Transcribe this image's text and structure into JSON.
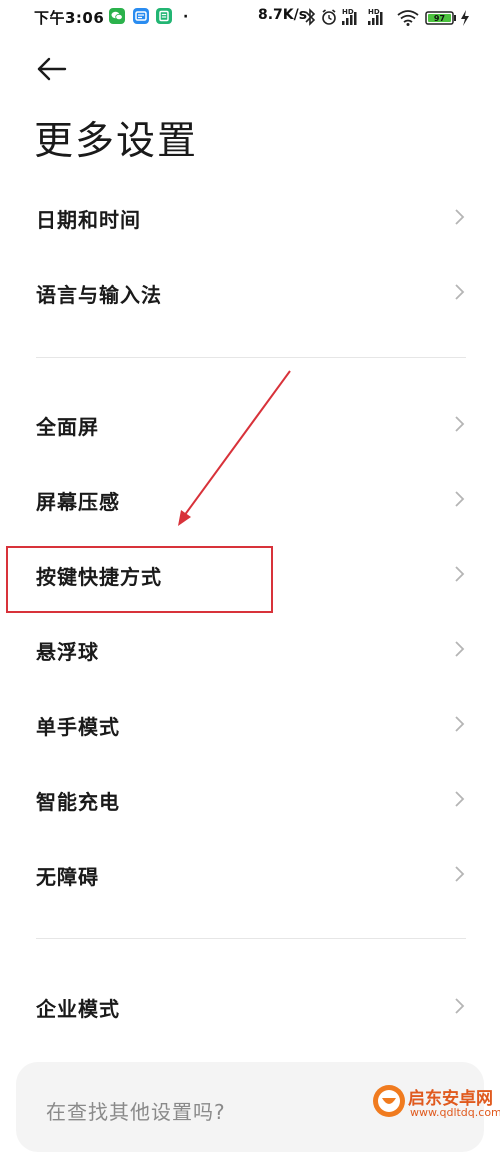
{
  "status_bar": {
    "time": "下午3:06",
    "dot": "·",
    "net_speed": "8.7K/s",
    "signal_label": "HD",
    "battery": "97"
  },
  "header": {
    "title": "更多设置"
  },
  "settings": {
    "group1": [
      "日期和时间",
      "语言与输入法"
    ],
    "group2": [
      "全面屏",
      "屏幕压感",
      "按键快捷方式",
      "悬浮球",
      "单手模式",
      "智能充电",
      "无障碍"
    ],
    "group3": [
      "企业模式"
    ]
  },
  "search_prompt": "在查找其他设置吗?",
  "watermark": {
    "name": "启东安卓网",
    "url": "www.qdltdq.com"
  },
  "colors": {
    "highlight": "#d8323a",
    "chevron": "#b5b5b5",
    "divider": "#e6e6e6"
  }
}
